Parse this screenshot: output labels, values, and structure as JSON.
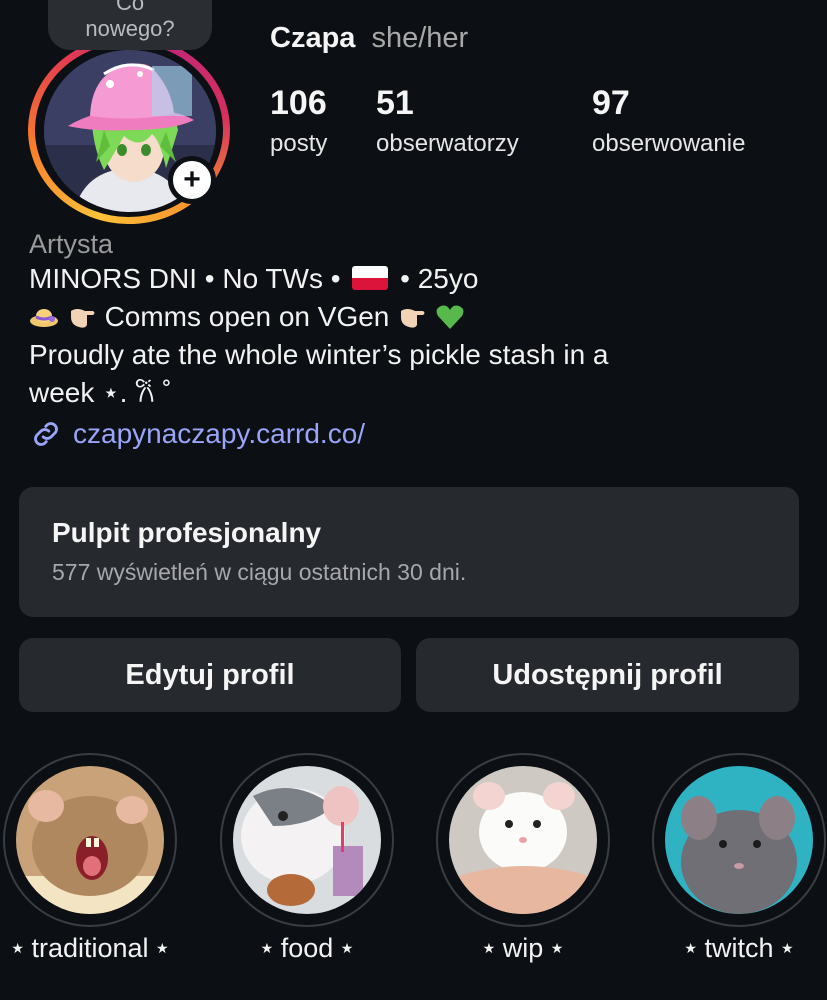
{
  "note": {
    "line1": "Co",
    "line2": "nowego?"
  },
  "profile": {
    "name": "Czapa",
    "pronouns": "she/her",
    "category": "Artysta"
  },
  "stats": [
    {
      "value": "106",
      "label": "posty"
    },
    {
      "value": "51",
      "label": "obserwatorzy"
    },
    {
      "value": "97",
      "label": "obserwowanie"
    }
  ],
  "bio": {
    "line1_a": "MINORS DNI • No TWs •",
    "line1_b": "• 25yo",
    "line2": "Comms open on VGen",
    "line3": "Proudly ate the whole winter’s pickle stash in a",
    "line4": "week ⋆. 𐙚 ˚",
    "link": "czapynaczapy.carrd.co/"
  },
  "dashboard": {
    "title": "Pulpit profesjonalny",
    "subtitle": "577 wyświetleń w ciągu ostatnich 30 dni."
  },
  "buttons": {
    "edit": "Edytuj profil",
    "share": "Udostępnij profil"
  },
  "highlights": [
    {
      "label": "traditional"
    },
    {
      "label": "food"
    },
    {
      "label": "wip"
    },
    {
      "label": "twitch"
    }
  ],
  "colors": {
    "background": "#0c1014",
    "card": "#26292e",
    "link": "#9aa4f8",
    "story_ring_start": "#fdc23a",
    "story_ring_end": "#c0277a"
  }
}
